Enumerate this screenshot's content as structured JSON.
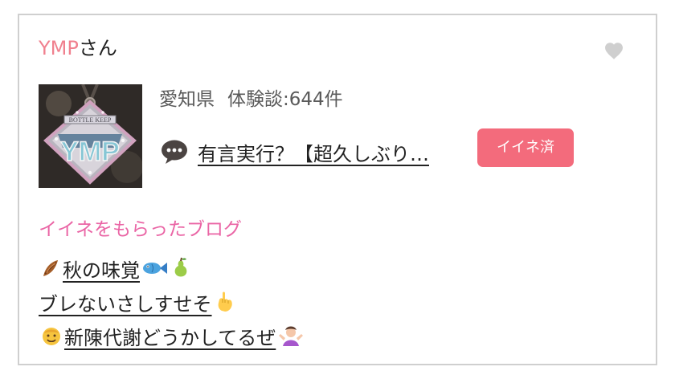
{
  "user": {
    "name": "YMP",
    "suffix": "さん"
  },
  "profile": {
    "prefecture": "愛知県",
    "experience_count": "体験談:644件"
  },
  "blog": {
    "title": "有言実行？【超久しぶり…",
    "button_label": "イイネ済"
  },
  "liked_section": {
    "title": "イイネをもらったブログ",
    "items": [
      {
        "label": "秋の味覚",
        "icons": [
          "leaf-icon",
          "fish-icon",
          "pear-icon"
        ]
      },
      {
        "label": "ブレないさしすせそ",
        "icons": [
          "point-up-icon"
        ]
      },
      {
        "label": "新陳代謝どうかしてるぜ",
        "icons": [
          "smile-icon",
          "shrug-icon"
        ]
      }
    ]
  },
  "avatar_text": {
    "keep_label": "BOTTLE KEEP",
    "badge_text": "YMP"
  },
  "colors": {
    "username": "#f0808e",
    "section_title": "#ea65a5",
    "button_bg": "#f36b7c",
    "border": "#cfcfcf",
    "heart": "#cfcfcf"
  }
}
